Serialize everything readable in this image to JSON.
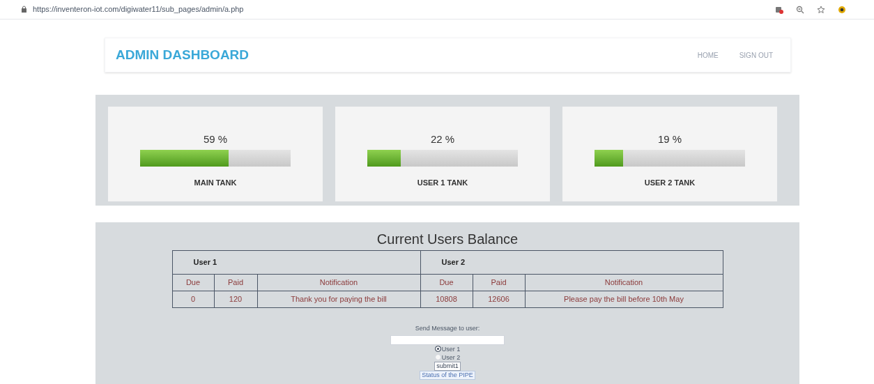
{
  "browser": {
    "url": "https://inventeron-iot.com/digiwater11/sub_pages/admin/a.php"
  },
  "header": {
    "title": "ADMIN DASHBOARD",
    "nav": [
      "HOME",
      "SIGN OUT"
    ]
  },
  "tanks": [
    {
      "reading": "59 %",
      "level": 0.59,
      "name": "MAIN TANK"
    },
    {
      "reading": "22 %",
      "level": 0.22,
      "name": "USER 1 TANK"
    },
    {
      "reading": "19 %",
      "level": 0.19,
      "name": "USER 2 TANK"
    }
  ],
  "balance": {
    "title": "Current Users Balance",
    "users": [
      {
        "name": "User 1",
        "columns": [
          "Due",
          "Paid",
          "Notification"
        ],
        "values": [
          "0",
          "120",
          "Thank you for paying the bill"
        ]
      },
      {
        "name": "User 2",
        "columns": [
          "Due",
          "Paid",
          "Notification"
        ],
        "values": [
          "10808",
          "12606",
          "Please pay the bill before 10th May"
        ]
      }
    ]
  },
  "message_form": {
    "label": "Send Message to user:",
    "options": [
      {
        "label": "User 1",
        "selected": true
      },
      {
        "label": "User 2",
        "selected": false
      }
    ],
    "submit": "submit1",
    "link": "Status of the PIPE"
  }
}
